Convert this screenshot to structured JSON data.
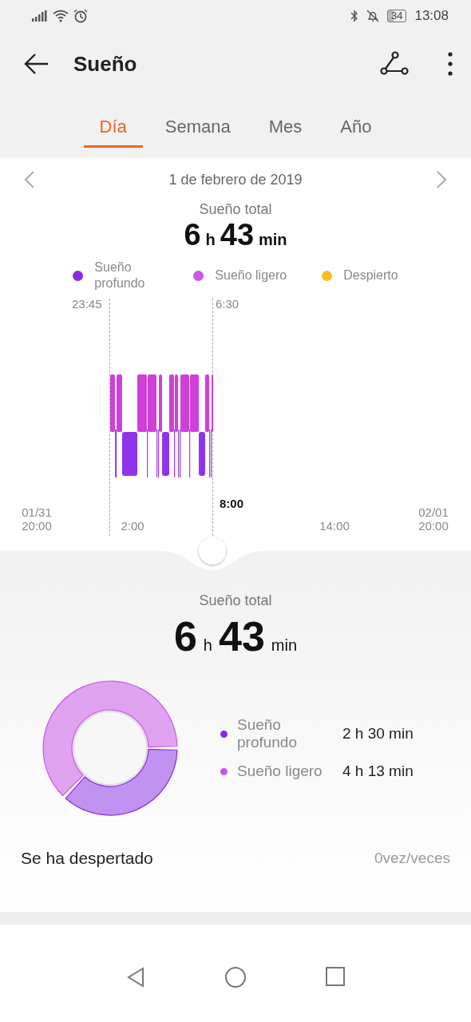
{
  "status_bar": {
    "battery": "34",
    "time": "13:08"
  },
  "header": {
    "title": "Sueño"
  },
  "tabs": [
    {
      "label": "Día",
      "selected": true
    },
    {
      "label": "Semana",
      "selected": false
    },
    {
      "label": "Mes",
      "selected": false
    },
    {
      "label": "Año",
      "selected": false
    }
  ],
  "date_nav": {
    "date": "1 de febrero de 2019"
  },
  "summary": {
    "label": "Sueño total",
    "parts": [
      {
        "text": "6",
        "kind": "number"
      },
      {
        "text": "h",
        "kind": "unit"
      },
      {
        "text": "43",
        "kind": "number"
      },
      {
        "text": "min",
        "kind": "unit"
      }
    ]
  },
  "legend": [
    {
      "label": "Sueño profundo",
      "color": "#8a2be2"
    },
    {
      "label": "Sueño ligero",
      "color": "#cc55e6"
    },
    {
      "label": "Despierto",
      "color": "#fbbc1f"
    }
  ],
  "timeline": {
    "start_label": "23:45",
    "end_label": "6:30",
    "cursor_label": "8:00",
    "axis_labels": [
      {
        "lines": [
          "01/31",
          "20:00"
        ]
      },
      {
        "lines": [
          "2:00"
        ]
      },
      {
        "lines": [
          "14:00"
        ]
      },
      {
        "lines": [
          "02/01",
          "20:00"
        ]
      }
    ]
  },
  "detail": {
    "label": "Sueño total",
    "parts": [
      {
        "text": "6",
        "kind": "number"
      },
      {
        "text": "h",
        "kind": "unit"
      },
      {
        "text": "43",
        "kind": "number"
      },
      {
        "text": "min",
        "kind": "unit"
      }
    ],
    "chart_data": {
      "type": "donut",
      "categories": [
        "Sueño profundo",
        "Sueño ligero"
      ],
      "values": [
        37,
        63
      ]
    },
    "rows": [
      {
        "duration": "2 h 30 min",
        "color": "#8a2be2"
      },
      {
        "duration": "4 h 13 min",
        "color": "#cc55e6"
      }
    ]
  },
  "awake": {
    "label": "Se ha despertado",
    "value": "0vez/veces"
  }
}
